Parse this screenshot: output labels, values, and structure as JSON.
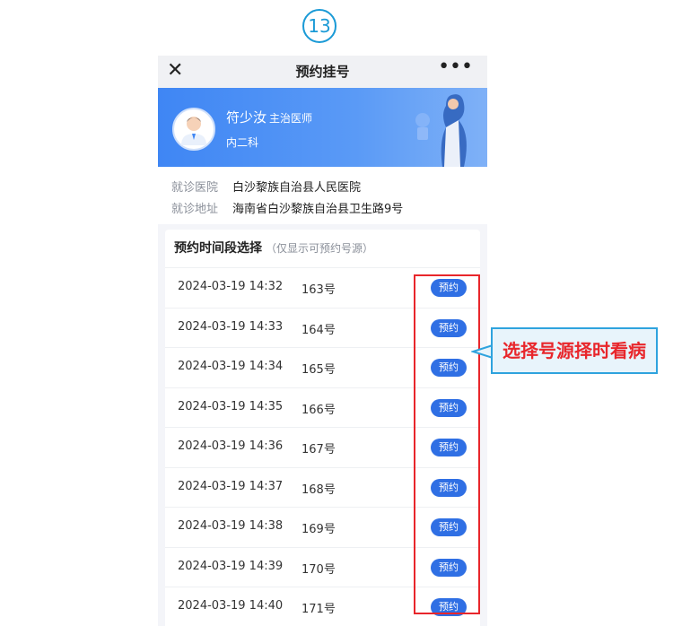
{
  "step_number": "13",
  "nav": {
    "close_icon": "close-icon",
    "title": "预约挂号",
    "more_icon": "more-dots-icon"
  },
  "doctor": {
    "name": "符少汝",
    "title": "主治医师",
    "department": "内二科"
  },
  "info": {
    "hospital_label": "就诊医院",
    "hospital_value": "白沙黎族自治县人民医院",
    "address_label": "就诊地址",
    "address_value": "海南省白沙黎族自治县卫生路9号"
  },
  "slots": {
    "heading": "预约时间段选择",
    "note": "（仅显示可预约号源）",
    "items": [
      {
        "time": "2024-03-19 14:32",
        "number": "163号",
        "button": "预约"
      },
      {
        "time": "2024-03-19 14:33",
        "number": "164号",
        "button": "预约"
      },
      {
        "time": "2024-03-19 14:34",
        "number": "165号",
        "button": "预约"
      },
      {
        "time": "2024-03-19 14:35",
        "number": "166号",
        "button": "预约"
      },
      {
        "time": "2024-03-19 14:36",
        "number": "167号",
        "button": "预约"
      },
      {
        "time": "2024-03-19 14:37",
        "number": "168号",
        "button": "预约"
      },
      {
        "time": "2024-03-19 14:38",
        "number": "169号",
        "button": "预约"
      },
      {
        "time": "2024-03-19 14:39",
        "number": "170号",
        "button": "预约"
      },
      {
        "time": "2024-03-19 14:40",
        "number": "171号",
        "button": "预约"
      }
    ]
  },
  "annotation": {
    "callout_text": "选择号源择时看病"
  },
  "colors": {
    "accent": "#2f6fe4",
    "banner": "#3f86f4",
    "highlight": "#e8262b",
    "callout_border": "#2ea3de"
  }
}
